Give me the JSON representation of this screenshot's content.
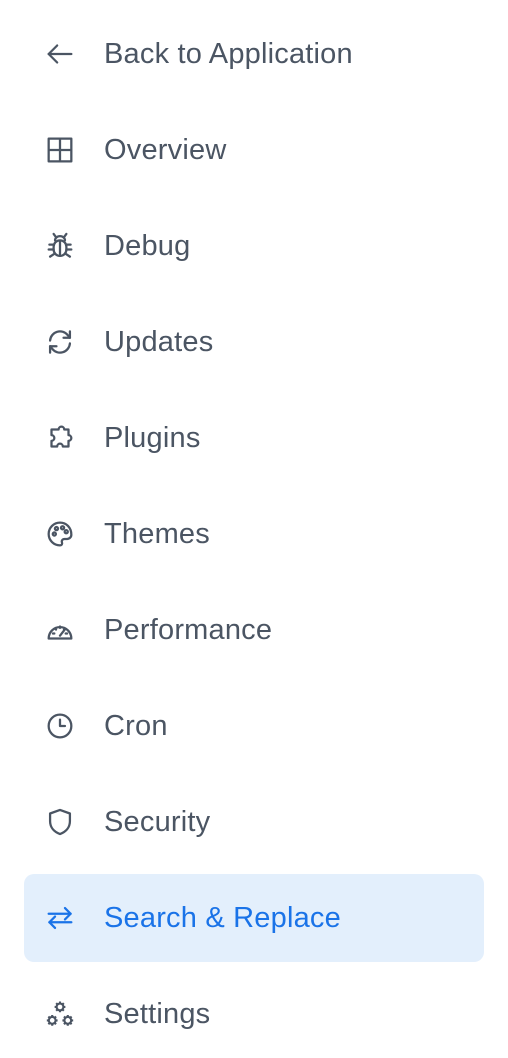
{
  "nav": {
    "items": [
      {
        "label": "Back to Application",
        "icon": "arrow-left-icon"
      },
      {
        "label": "Overview",
        "icon": "grid-icon"
      },
      {
        "label": "Debug",
        "icon": "bug-icon"
      },
      {
        "label": "Updates",
        "icon": "refresh-icon"
      },
      {
        "label": "Plugins",
        "icon": "puzzle-icon"
      },
      {
        "label": "Themes",
        "icon": "palette-icon"
      },
      {
        "label": "Performance",
        "icon": "speedometer-icon"
      },
      {
        "label": "Cron",
        "icon": "clock-icon"
      },
      {
        "label": "Security",
        "icon": "shield-icon"
      },
      {
        "label": "Search & Replace",
        "icon": "arrows-exchange-icon",
        "active": true
      },
      {
        "label": "Settings",
        "icon": "cogs-icon"
      }
    ]
  },
  "colors": {
    "text": "#4b5563",
    "active_text": "#1a73e8",
    "active_bg": "#e3effc"
  }
}
